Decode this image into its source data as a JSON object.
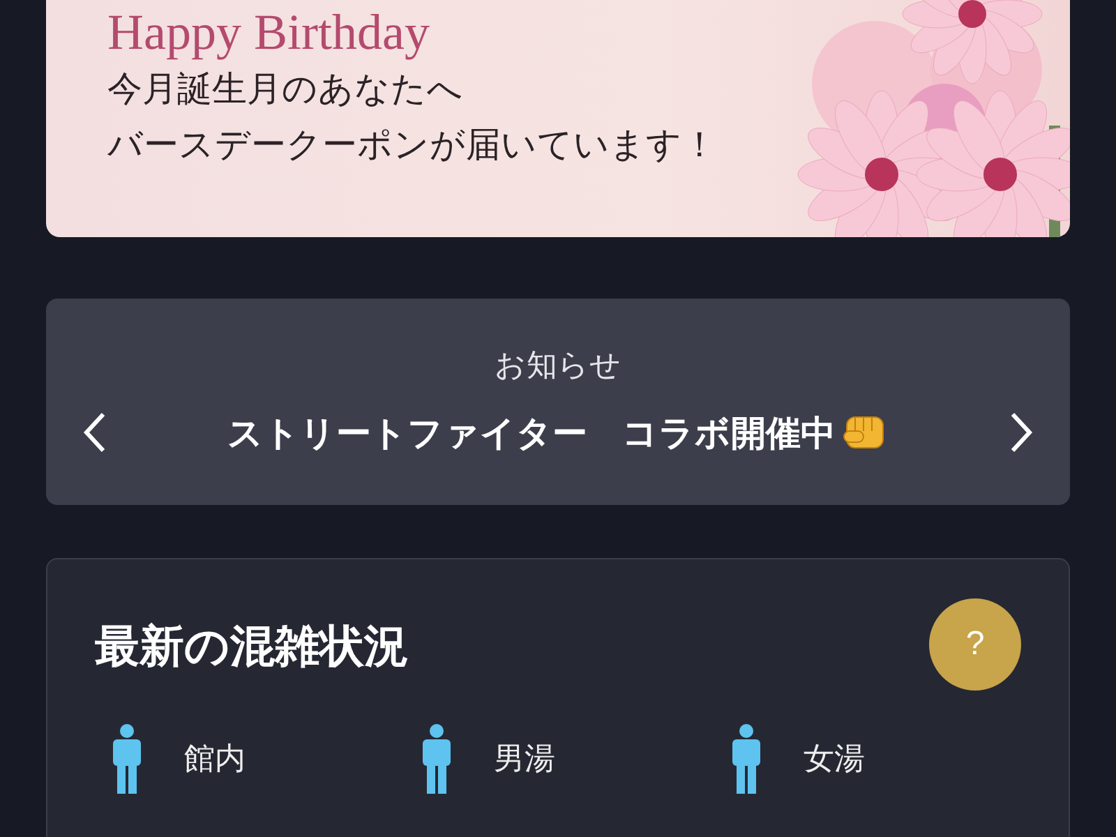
{
  "banner": {
    "title": "Happy Birthday",
    "lines": [
      "今月誕生月のあなたへ",
      "バースデークーポンが届いています！"
    ]
  },
  "notice": {
    "heading": "お知らせ",
    "message": "ストリートファイター　コラボ開催中"
  },
  "congestion": {
    "title": "最新の混雑状況",
    "help": "?",
    "areas": [
      {
        "label": "館内"
      },
      {
        "label": "男湯"
      },
      {
        "label": "女湯"
      }
    ]
  }
}
